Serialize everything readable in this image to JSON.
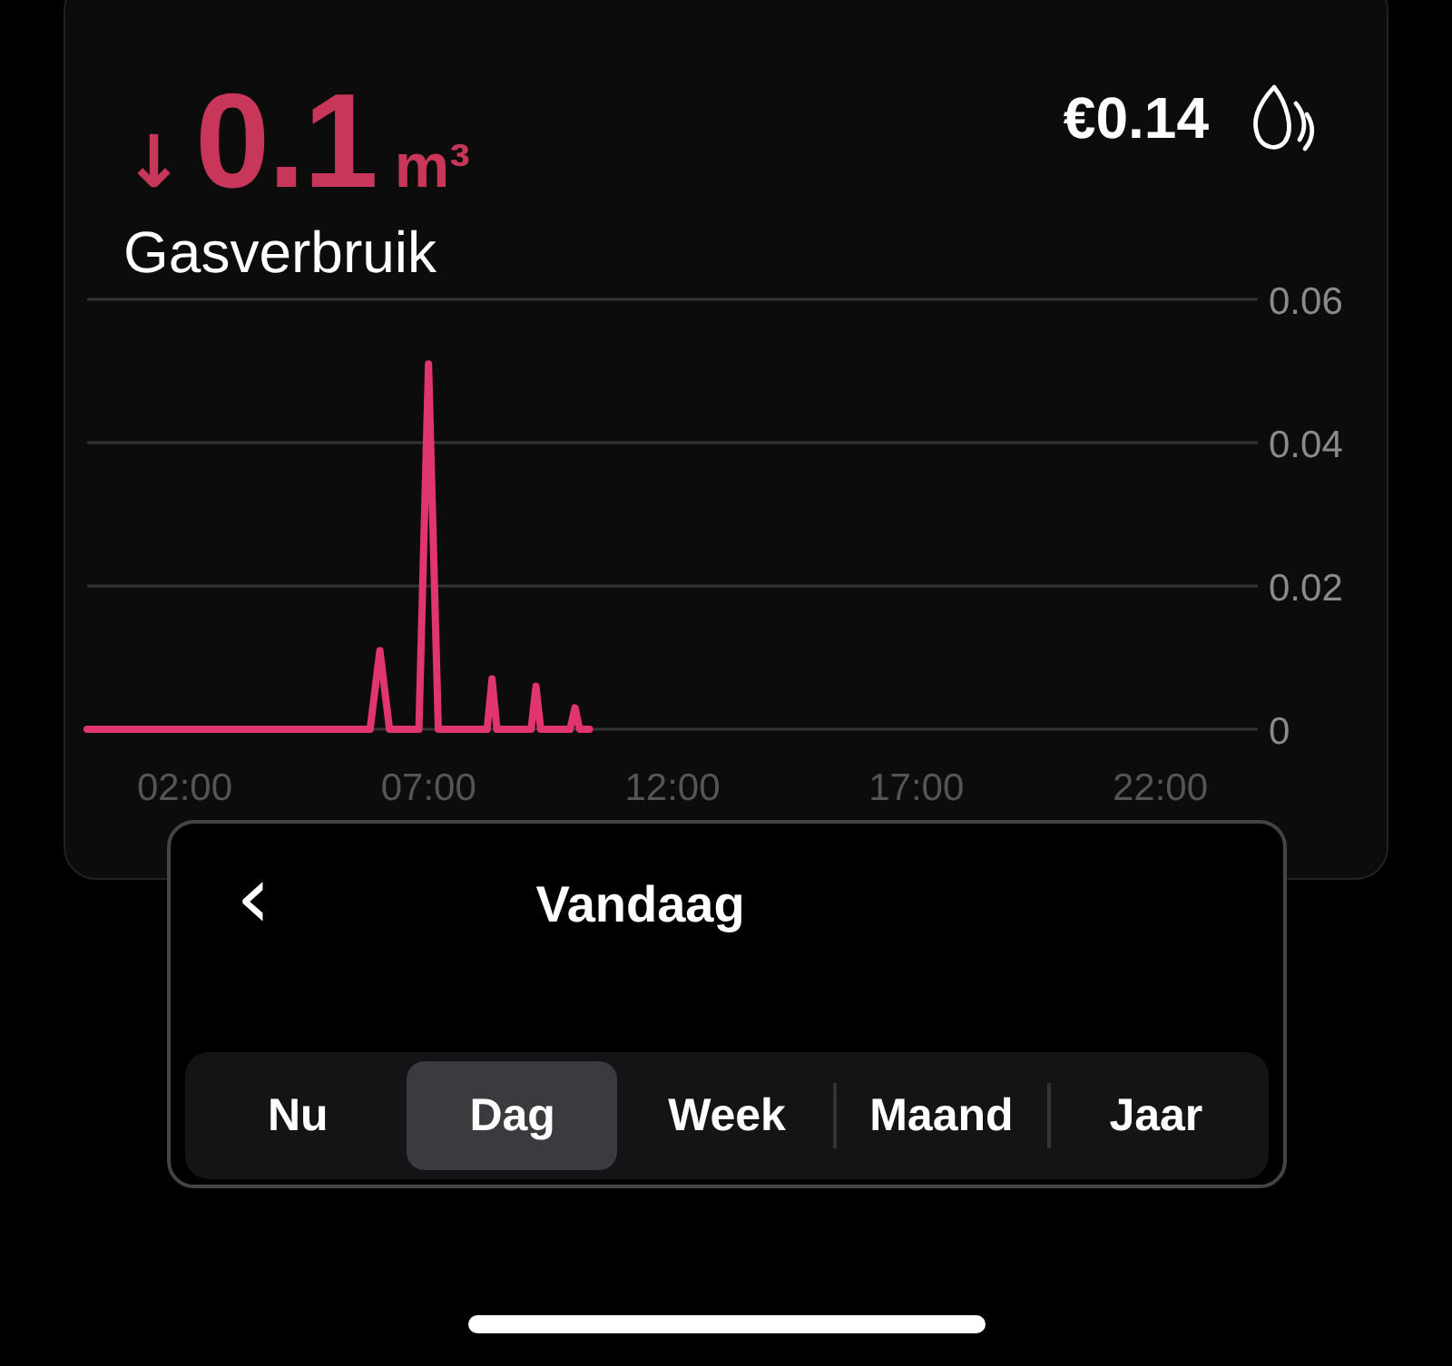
{
  "reading": {
    "arrow": "↓",
    "value": "0.1",
    "unit": "m³",
    "label": "Gasverbruik"
  },
  "cost": "€0.14",
  "chart": {
    "chart_data": {
      "type": "line",
      "x": [
        0,
        5.8,
        6.0,
        6.2,
        6.8,
        7.0,
        7.2,
        8.2,
        8.3,
        8.4,
        9.1,
        9.2,
        9.3,
        9.9,
        10.0,
        10.1,
        10.3
      ],
      "series": [
        {
          "color": "#e0356e",
          "values": [
            0,
            0,
            0.011,
            0,
            0,
            0.051,
            0,
            0,
            0.007,
            0,
            0,
            0.006,
            0,
            0,
            0.003,
            0,
            0
          ]
        }
      ],
      "xlim": [
        0,
        24
      ],
      "ylim": [
        0,
        0.06
      ],
      "xticks": [
        {
          "value": 2,
          "label": "02:00"
        },
        {
          "value": 7,
          "label": "07:00"
        },
        {
          "value": 12,
          "label": "12:00"
        },
        {
          "value": 17,
          "label": "17:00"
        },
        {
          "value": 22,
          "label": "22:00"
        }
      ],
      "yticks": [
        {
          "value": 0,
          "label": "0"
        },
        {
          "value": 0.02,
          "label": "0.02"
        },
        {
          "value": 0.04,
          "label": "0.04"
        },
        {
          "value": 0.06,
          "label": "0.06"
        }
      ]
    }
  },
  "period_panel": {
    "back": "‹",
    "title": "Vandaag",
    "segments": [
      {
        "label": "Nu",
        "selected": false
      },
      {
        "label": "Dag",
        "selected": true
      },
      {
        "label": "Week",
        "selected": false
      },
      {
        "label": "Maand",
        "selected": false
      },
      {
        "label": "Jaar",
        "selected": false
      }
    ]
  }
}
